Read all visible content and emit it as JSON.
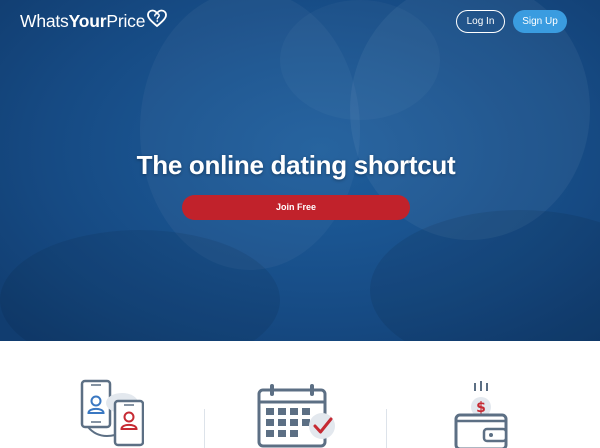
{
  "header": {
    "logo": {
      "part1": "Whats",
      "part2": "Your",
      "part3": "Price",
      "icon": "heart-question-icon"
    },
    "login_label": "Log In",
    "signup_label": "Sign Up"
  },
  "hero": {
    "headline": "The online dating shortcut",
    "cta_label": "Join Free"
  },
  "features": {
    "icons": [
      "phones-profile-icon",
      "calendar-check-icon",
      "wallet-dollar-icon"
    ]
  },
  "colors": {
    "hero_blue": "#164a83",
    "cta_red": "#c1222b",
    "signup_blue": "#3a9ce0",
    "icon_gray": "#5c6f84",
    "accent_red": "#c62a33"
  }
}
